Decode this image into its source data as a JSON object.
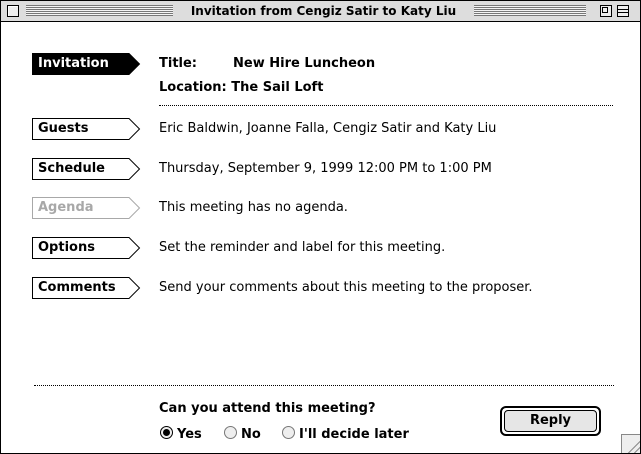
{
  "window": {
    "title": "Invitation from Cengiz Satir to Katy Liu"
  },
  "tabs": [
    {
      "label": "Invitation",
      "state": "active"
    },
    {
      "label": "Guests",
      "state": "normal"
    },
    {
      "label": "Schedule",
      "state": "normal"
    },
    {
      "label": "Agenda",
      "state": "disabled"
    },
    {
      "label": "Options",
      "state": "normal"
    },
    {
      "label": "Comments",
      "state": "normal"
    }
  ],
  "invitation": {
    "title_label": "Title:",
    "title_value": "New Hire Luncheon",
    "location_label": "Location:",
    "location_value": "The Sail Loft"
  },
  "rows": {
    "guests": "Eric Baldwin, Joanne Falla, Cengiz Satir and Katy Liu",
    "schedule": "Thursday, September 9, 1999 12:00 PM to  1:00 PM",
    "agenda": "This meeting has no agenda.",
    "options": "Set the reminder and label for this meeting.",
    "comments": "Send your comments about this meeting to the proposer."
  },
  "attendance": {
    "question": "Can you attend this meeting?",
    "options": [
      "Yes",
      "No",
      "I'll decide later"
    ],
    "selected": "Yes"
  },
  "reply_button": "Reply",
  "colors": {
    "active_tab": "#000000",
    "disabled_text": "#a8a8a8",
    "titlebar": "#dddddd"
  }
}
